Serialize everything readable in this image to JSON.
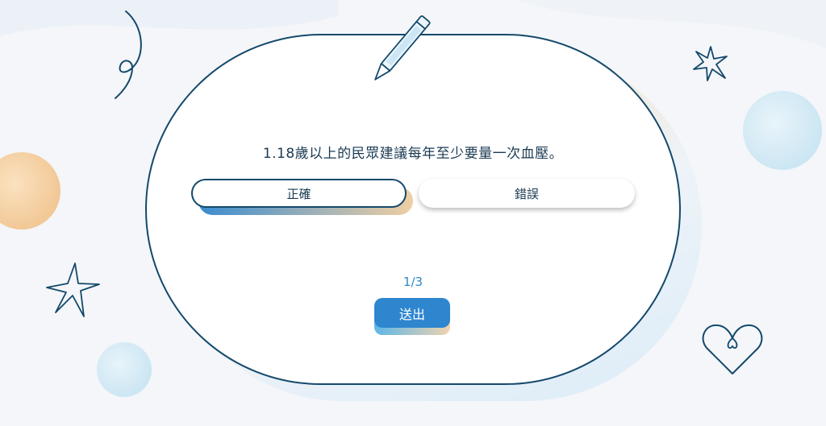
{
  "quiz": {
    "question": "1.18歲以上的民眾建議每年至少要量一次血壓。",
    "options": [
      {
        "label": "正確"
      },
      {
        "label": "錯誤"
      }
    ],
    "progress": "1/3",
    "submit_label": "送出"
  },
  "colors": {
    "primary": "#2e86cf",
    "outline": "#14496b",
    "accent_orange": "#f0cfa3",
    "accent_blue": "#d4ebf6",
    "text": "#1a3a52"
  },
  "icons": [
    "pencil-icon",
    "star-icon",
    "heart-icon",
    "swirl-icon"
  ]
}
